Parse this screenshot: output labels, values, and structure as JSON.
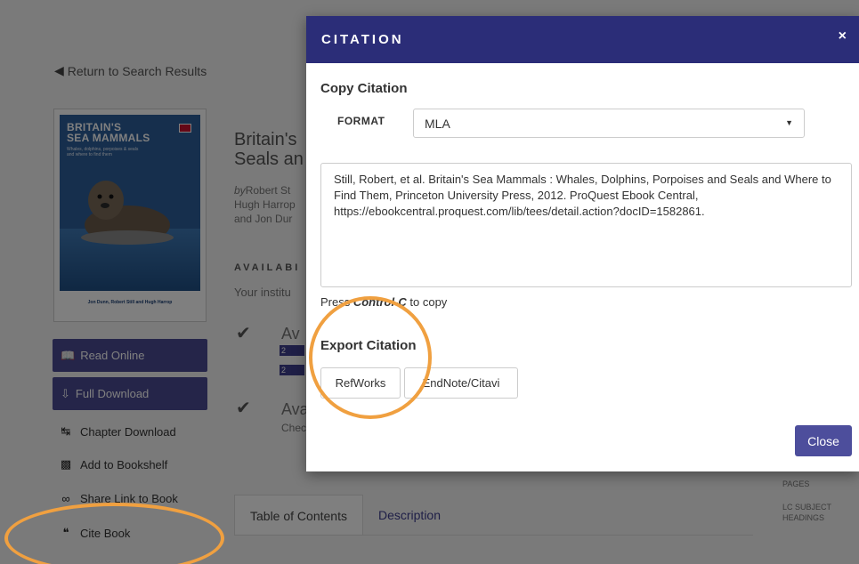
{
  "background": {
    "back_link": "Return to Search Results",
    "book": {
      "title_line1": "Britain's",
      "title_line2": "Seals an",
      "authors_by": "by",
      "authors_line1": "Robert St",
      "authors_line2": "Hugh Harrop",
      "authors_line3": "and Jon Dur",
      "availability_label": "AVAILABI",
      "availability_text": "Your institu",
      "avail1": "Av",
      "badge1": "2",
      "badge2": "2",
      "avail2": "Ava",
      "avail2_sub": "Chec"
    },
    "cover": {
      "title_line1": "BRITAIN'S",
      "title_line2": "SEA MAMMALS",
      "subtitle": "Whales, dolphins, porpoises & seals and where to find them",
      "authors": "Jon Dunn, Robert Still and Hugh Harrop"
    },
    "actions": {
      "read_online": "Read Online",
      "full_download": "Full Download",
      "chapter_download": "Chapter Download",
      "add_to_bookshelf": "Add to Bookshelf",
      "share_link": "Share Link to Book",
      "cite_book": "Cite Book"
    },
    "tabs": [
      "Table of Contents",
      "Description"
    ],
    "meta": {
      "pages": "PAGES",
      "lc_subject_1": "LC SUBJECT",
      "lc_subject_2": "HEADINGS"
    }
  },
  "modal": {
    "title": "CITATION",
    "close_x": "×",
    "copy_heading": "Copy Citation",
    "format_label": "FORMAT",
    "format_value": "MLA",
    "citation_text": "Still, Robert, et al. Britain's Sea Mammals : Whales, Dolphins, Porpoises and Seals and Where to Find Them, Princeton University Press, 2012. ProQuest Ebook Central, https://ebookcentral.proquest.com/lib/tees/detail.action?docID=1582861.",
    "copy_hint_prefix": "Press ",
    "copy_hint_key": "Control-C",
    "copy_hint_suffix": " to copy",
    "export_heading": "Export Citation",
    "export_refworks": "RefWorks",
    "export_endnote": "EndNote/Citavi",
    "close_label": "Close"
  },
  "colors": {
    "header_bg": "#2b2d78",
    "primary_button": "#4d4e9c",
    "annotation": "#f0a040"
  }
}
